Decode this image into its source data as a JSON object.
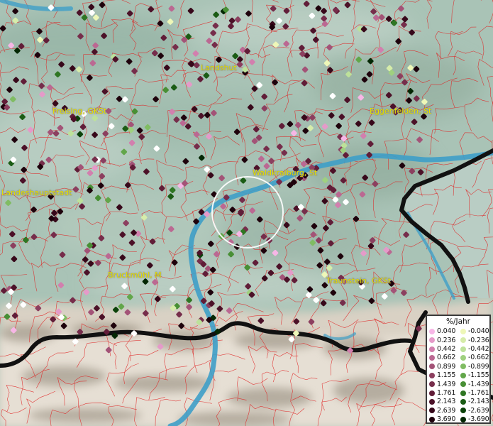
{
  "places": [
    {
      "name": "Landshut",
      "key": "landshut"
    },
    {
      "name": "Freising, GKSt",
      "key": "freising"
    },
    {
      "name": "Eggenfelden, St",
      "key": "eggenfelden"
    },
    {
      "name": "Waldkraiburg, St",
      "key": "waldkraiburg"
    },
    {
      "name": "Landeshauptstadt",
      "key": "landeshauptstadt"
    },
    {
      "name": "Bruckmühl, M",
      "key": "bruckmuehl"
    },
    {
      "name": "Traunstein, GKSt",
      "key": "traunstein"
    }
  ],
  "legend": {
    "title": "%/Jahr",
    "positive": [
      {
        "value": "0.040",
        "color": "#f7b6e6"
      },
      {
        "value": "0.236",
        "color": "#e59ac9"
      },
      {
        "value": "0.442",
        "color": "#d27fae"
      },
      {
        "value": "0.662",
        "color": "#bb6892"
      },
      {
        "value": "0.899",
        "color": "#a35377"
      },
      {
        "value": "1.155",
        "color": "#8c3f5f"
      },
      {
        "value": "1.439",
        "color": "#762d4b"
      },
      {
        "value": "1.761",
        "color": "#611d38"
      },
      {
        "value": "2.143",
        "color": "#4c1128"
      },
      {
        "value": "2.639",
        "color": "#37081a"
      },
      {
        "value": "3.690",
        "color": "#1e020c"
      }
    ],
    "negative": [
      {
        "value": "-0.040",
        "color": "#eef7b8"
      },
      {
        "value": "-0.236",
        "color": "#d6ecaa"
      },
      {
        "value": "-0.442",
        "color": "#bde19a"
      },
      {
        "value": "-0.662",
        "color": "#9fd07f"
      },
      {
        "value": "-0.899",
        "color": "#80bc63"
      },
      {
        "value": "-1.155",
        "color": "#62a64a"
      },
      {
        "value": "-1.439",
        "color": "#488f35"
      },
      {
        "value": "-1.761",
        "color": "#2f7623"
      },
      {
        "value": "-2.143",
        "color": "#1b5c15"
      },
      {
        "value": "-2.639",
        "color": "#0b4209"
      },
      {
        "value": "-3.690",
        "color": "#032703"
      }
    ]
  },
  "colors": {
    "terrain": "#a9c3b6",
    "boundaries": "#e02020",
    "river": "#3e9fc8",
    "border": "#111111",
    "mountains": "#dcd4c8",
    "place_label": "#e8e200",
    "highlight_circle": "#ffffff"
  }
}
